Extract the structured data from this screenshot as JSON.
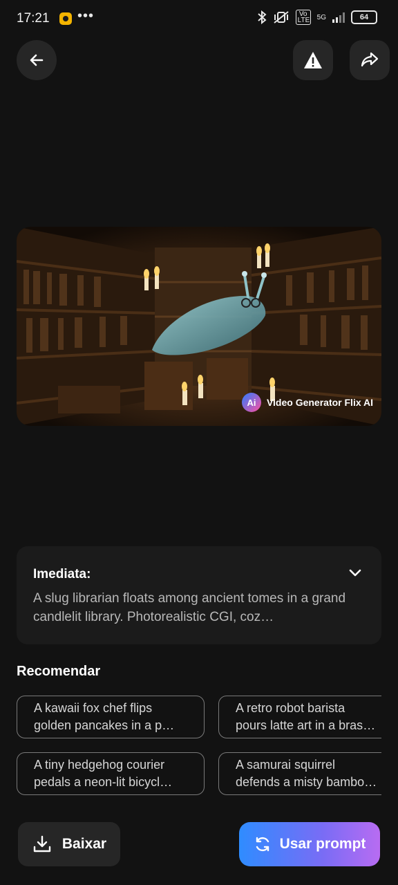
{
  "status_bar": {
    "time": "17:21",
    "dots": "•••",
    "volte": "Vo LTE",
    "network": "5G",
    "battery": "64"
  },
  "top_bar": {
    "icons": [
      "back-arrow-icon",
      "warning-icon",
      "share-icon"
    ]
  },
  "video": {
    "watermark_logo": "Ai",
    "watermark_text": "Video Generator Flix AI"
  },
  "prompt_card": {
    "title": "Imediata:",
    "text": "A slug librarian floats among ancient tomes in a grand candlelit library. Photorealistic CGI, coz…"
  },
  "recommend": {
    "title": "Recomendar",
    "chips": [
      {
        "line1": "A kawaii fox chef flips",
        "line2": "golden pancakes in a p…"
      },
      {
        "line1": "A retro robot barista",
        "line2": "pours latte art in a bras…"
      },
      {
        "line1": "A tiny hedgehog courier",
        "line2": "pedals a neon-lit bicycl…"
      },
      {
        "line1": "A samurai squirrel",
        "line2": "defends a misty bambo…"
      }
    ]
  },
  "bottom": {
    "download_label": "Baixar",
    "use_prompt_label": "Usar prompt"
  },
  "colors": {
    "background": "#121212",
    "card": "#1b1b1b",
    "button": "#262626",
    "accent_start": "#2f8cff",
    "accent_end": "#b86cf2"
  }
}
